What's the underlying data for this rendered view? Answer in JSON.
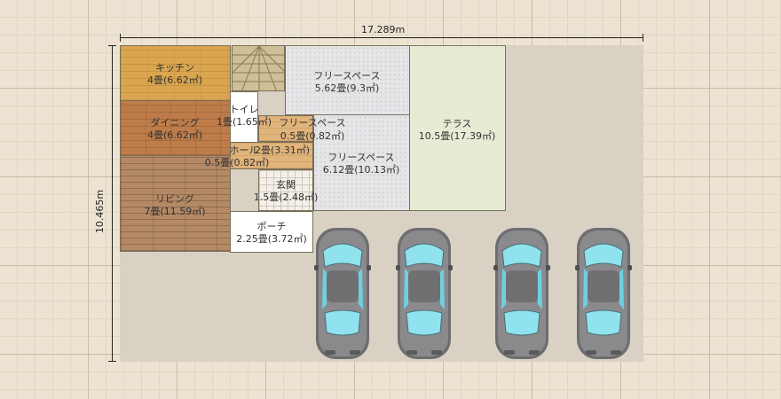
{
  "dimensions": {
    "width": "17.289m",
    "height": "10.465m"
  },
  "rooms": {
    "kitchen": {
      "name": "キッチン",
      "area": "4畳(6.62㎡)"
    },
    "dining": {
      "name": "ダイニング",
      "area": "4畳(6.62㎡)"
    },
    "living": {
      "name": "リビング",
      "area": "7畳(11.59㎡)"
    },
    "toilet": {
      "name": "トイレ",
      "area": "1畳(1.65㎡)"
    },
    "free_small": {
      "name": "フリースペース",
      "area": "0.5畳(0.82㎡)"
    },
    "hall1": {
      "name": "ホール",
      "area": "2畳(3.31㎡)"
    },
    "hall2": {
      "area": "0.5畳(0.82㎡)"
    },
    "genkan": {
      "name": "玄関",
      "area": "1.5畳(2.48㎡)"
    },
    "porch": {
      "name": "ポーチ",
      "area": "2.25畳(3.72㎡)"
    },
    "free_top": {
      "name": "フリースペース",
      "area": "5.62畳(9.3㎡)"
    },
    "free_mid": {
      "name": "フリースペース",
      "area": "6.12畳(10.13㎡)"
    },
    "terrace": {
      "name": "テラス",
      "area": "10.5畳(17.39㎡)"
    }
  },
  "cars": [
    {
      "name": "car-1"
    },
    {
      "name": "car-2"
    },
    {
      "name": "car-3"
    },
    {
      "name": "car-4"
    }
  ]
}
